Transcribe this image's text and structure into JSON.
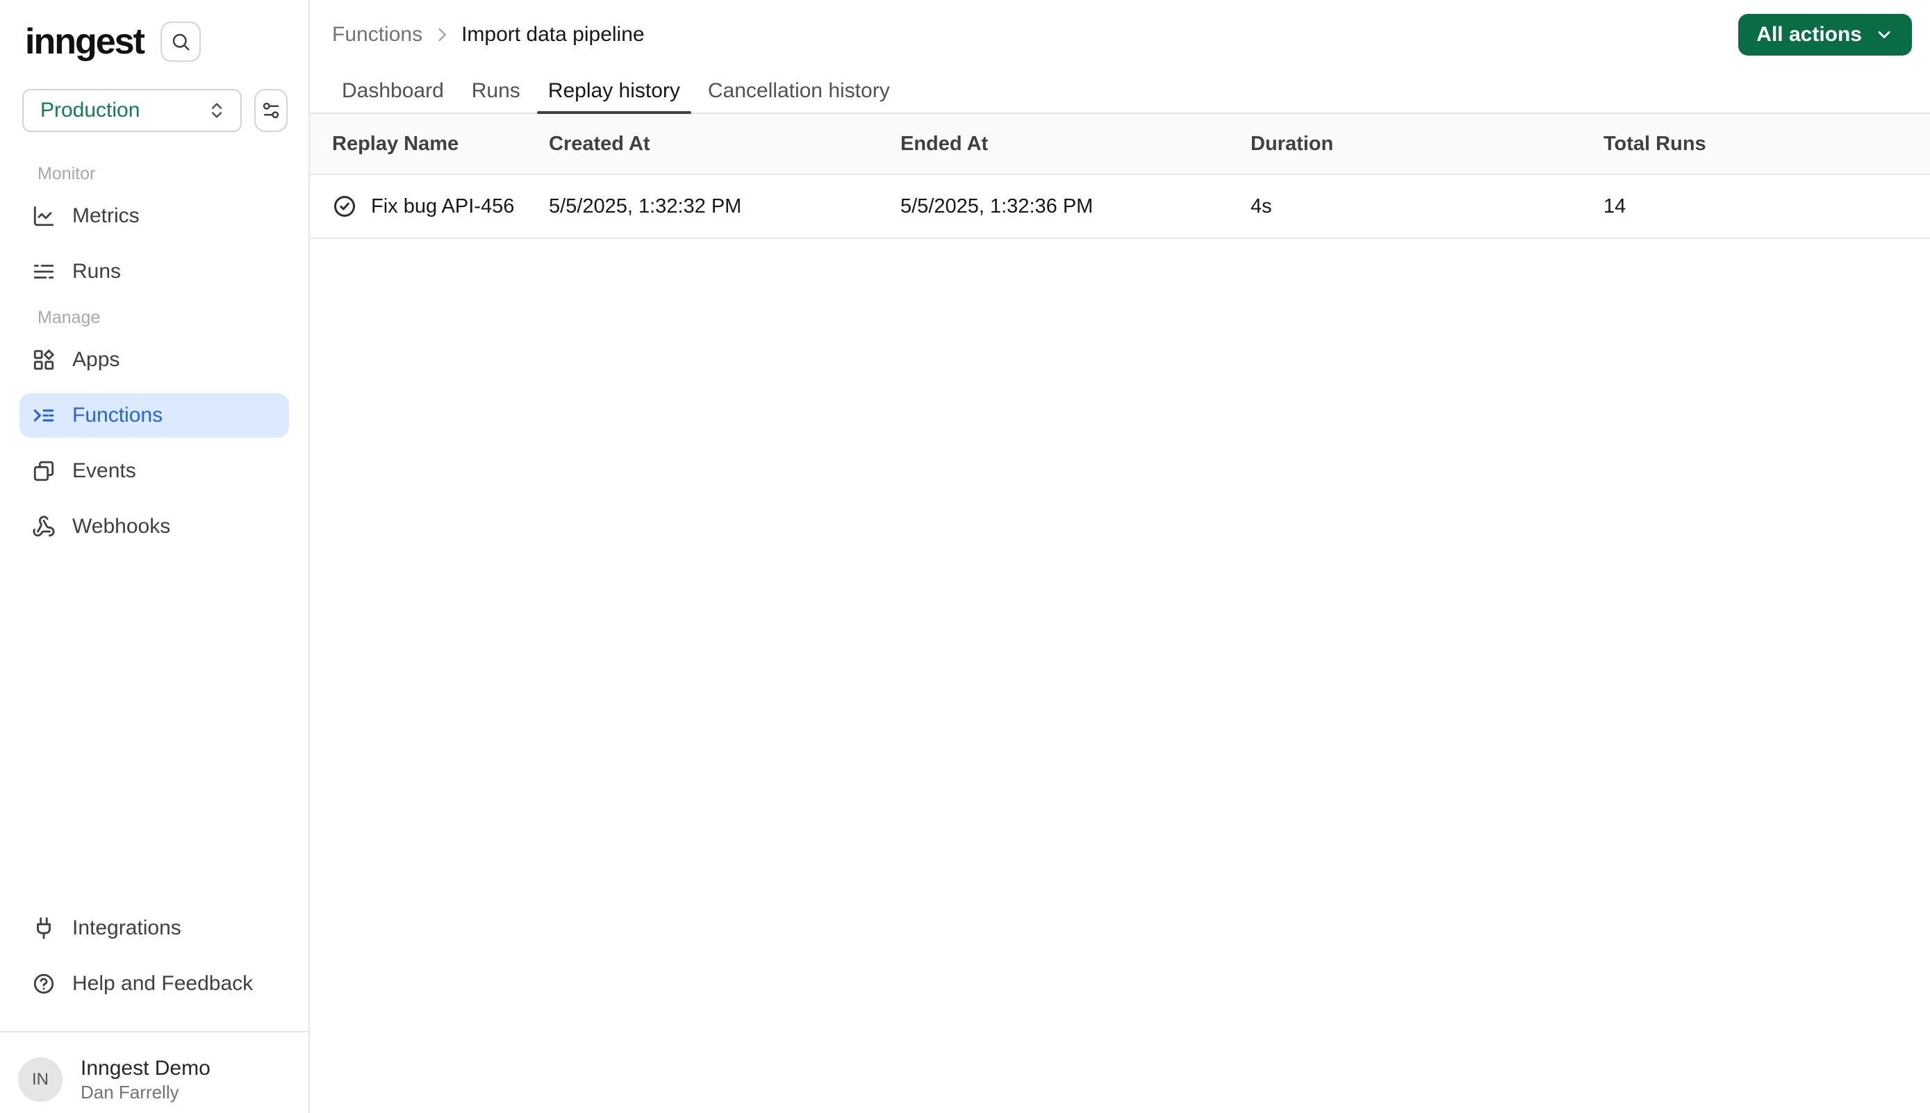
{
  "brand": {
    "logo_text": "inngest"
  },
  "colors": {
    "accent_green_button": "#0a6c44",
    "environment_green_text": "#0e7e53",
    "active_nav_blue": "#2563eb",
    "active_nav_bg": "#dbeafe",
    "border": "#e5e5e5",
    "table_header_bg": "#fafafa"
  },
  "sidebar": {
    "search_icon": "search-icon",
    "environment": {
      "selected": "Production",
      "icon": "chevrons-up-down-icon"
    },
    "env_settings_icon": "env-settings-icon",
    "sections": [
      {
        "label": "Monitor",
        "items": [
          {
            "label": "Metrics",
            "icon": "chart-line-icon",
            "active": false
          },
          {
            "label": "Runs",
            "icon": "runs-list-icon",
            "active": false
          }
        ]
      },
      {
        "label": "Manage",
        "items": [
          {
            "label": "Apps",
            "icon": "apps-grid-icon",
            "active": false
          },
          {
            "label": "Functions",
            "icon": "functions-list-icon",
            "active": true
          },
          {
            "label": "Events",
            "icon": "events-windows-icon",
            "active": false
          },
          {
            "label": "Webhooks",
            "icon": "webhook-icon",
            "active": false
          }
        ]
      }
    ],
    "footer_items": [
      {
        "label": "Integrations",
        "icon": "plug-icon"
      },
      {
        "label": "Help and Feedback",
        "icon": "help-circle-icon"
      }
    ],
    "user": {
      "initials": "IN",
      "org": "Inngest Demo",
      "name": "Dan Farrelly"
    }
  },
  "header": {
    "breadcrumb": {
      "parent": "Functions",
      "current": "Import data pipeline"
    },
    "actions_button": {
      "label": "All actions",
      "icon": "chevron-down-icon"
    }
  },
  "tabs": [
    {
      "label": "Dashboard",
      "active": false
    },
    {
      "label": "Runs",
      "active": false
    },
    {
      "label": "Replay history",
      "active": true
    },
    {
      "label": "Cancellation history",
      "active": false
    }
  ],
  "table": {
    "columns": [
      "Replay Name",
      "Created At",
      "Ended At",
      "Duration",
      "Total Runs"
    ],
    "rows": [
      {
        "status_icon": "check-circle-icon",
        "name": "Fix bug API-456",
        "created_at": "5/5/2025, 1:32:32 PM",
        "ended_at": "5/5/2025, 1:32:36 PM",
        "duration": "4s",
        "total_runs": "14"
      }
    ]
  }
}
